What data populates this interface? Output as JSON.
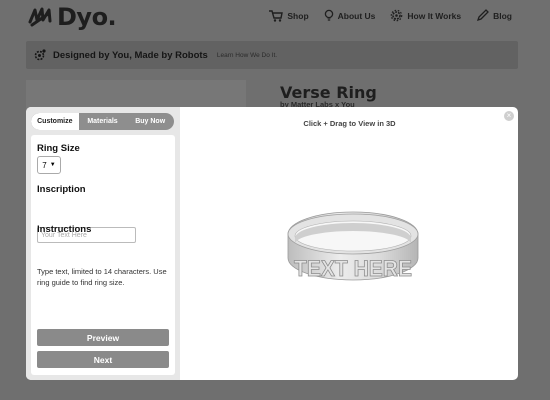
{
  "brand": {
    "name": "Dyo."
  },
  "nav": [
    {
      "label": "Shop",
      "icon": "cart-icon"
    },
    {
      "label": "About Us",
      "icon": "lightbulb-icon"
    },
    {
      "label": "How It Works",
      "icon": "gear-icon"
    },
    {
      "label": "Blog",
      "icon": "pencil-icon"
    }
  ],
  "banner": {
    "title": "Designed by You, Made by Robots",
    "link": "Learn How We Do It.",
    "icon": "robot-gear-icon"
  },
  "product": {
    "title": "Verse Ring",
    "subtitle": "by Matter Labs x You"
  },
  "modal": {
    "tabs": [
      "Customize",
      "Materials",
      "Buy Now"
    ],
    "active_tab": "Customize",
    "ring_size": {
      "label": "Ring Size",
      "value": "7"
    },
    "inscription": {
      "label": "Inscription",
      "placeholder": "Your Text Here"
    },
    "instructions": {
      "label": "Instructions",
      "text": "Type text, limited to 14 characters. Use ring guide to find ring size."
    },
    "buttons": {
      "preview": "Preview",
      "next": "Next"
    },
    "viewer_caption": "Click + Drag to View in 3D",
    "ring_text": "TEXT HERE",
    "close_icon": "close-icon"
  },
  "colors": {
    "overlay": "#6f6f6f",
    "button": "#8a8a8a",
    "panel": "#e7e7e7"
  }
}
